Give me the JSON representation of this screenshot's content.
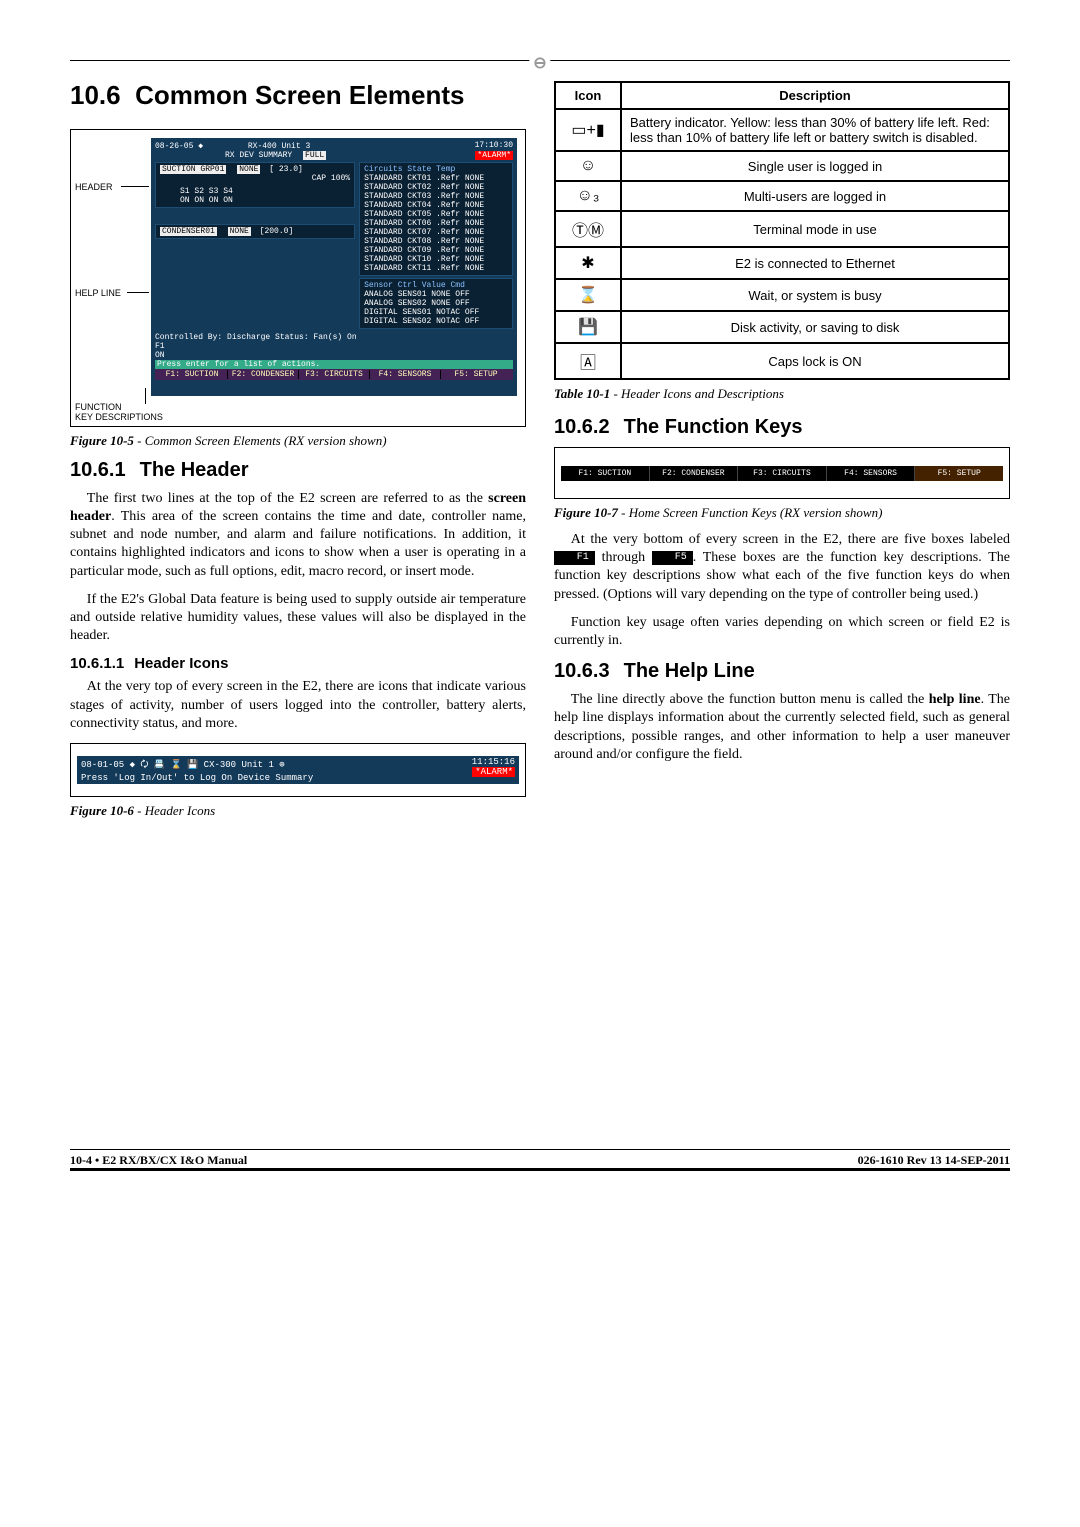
{
  "section": {
    "number": "10.6",
    "title": "Common Screen Elements"
  },
  "fig10_5": {
    "caption_num": "Figure 10-5",
    "caption_text": " - Common Screen Elements (RX version shown)",
    "labels": {
      "header": "HEADER",
      "help_line": "HELP LINE",
      "function": "FUNCTION",
      "key_desc": "KEY DESCRIPTIONS"
    },
    "header_row_left": "08-26-05 ◆",
    "header_row_mid": "RX-400 Unit 3",
    "header_row_time": "17:10:30",
    "header_row2": "RX DEV SUMMARY",
    "header_full": "FULL",
    "header_alarm": "*ALARM*",
    "block1_title": "SUCTION GRP01",
    "block1_none": "NONE",
    "block1_val": "[ 23.0]",
    "block1_cap": "CAP 100%",
    "s_header": "S1  S2  S3  S4",
    "s_row": "ON  ON  ON  ON",
    "circuits_title": "Circuits        State Temp",
    "circuits": [
      "STANDARD CKT01 .Refr NONE",
      "STANDARD CKT02 .Refr NONE",
      "STANDARD CKT03 .Refr NONE",
      "STANDARD CKT04 .Refr NONE",
      "STANDARD CKT05 .Refr NONE",
      "STANDARD CKT06 .Refr NONE",
      "STANDARD CKT07 .Refr NONE",
      "STANDARD CKT08 .Refr NONE",
      "STANDARD CKT09 .Refr NONE",
      "STANDARD CKT10 .Refr NONE",
      "STANDARD CKT11 .Refr NONE"
    ],
    "block2_title": "CONDENSER01",
    "block2_none": "NONE",
    "block2_val": "[200.0]",
    "sensor_title": "Sensor Ctrl    Value  Cmd",
    "sensors": [
      "ANALOG SENS01  NONE   OFF",
      "ANALOG SENS02  NONE   OFF",
      "DIGITAL SENS01 NOTAC  OFF",
      "DIGITAL SENS02 NOTAC  OFF"
    ],
    "help_line_text": "Controlled By: Discharge    Status: Fan(s) On",
    "f_line": "F1\nON",
    "enter_hint": "Press enter for a list of actions.",
    "fkeys": [
      "F1: SUCTION",
      "F2: CONDENSER",
      "F3: CIRCUITS",
      "F4: SENSORS",
      "F5: SETUP"
    ]
  },
  "sub_10_6_1": {
    "num": "10.6.1",
    "title": "The Header",
    "p1": "The first two lines at the top of the E2 screen are referred to as the ",
    "p1b": "screen header",
    "p1c": ". This area of the screen contains the time and date, controller name, subnet and node number, and alarm and failure notifications. In addition, it contains highlighted indicators and icons to show when a user is operating in a particular mode, such as full options, edit, macro record, or insert mode.",
    "p2": "If the E2's Global Data feature is being used to supply outside air temperature and outside relative humidity values, these values will also be displayed in the header."
  },
  "sub_10_6_1_1": {
    "num": "10.6.1.1",
    "title": "Header Icons",
    "p1": "At the very top of every screen in the E2, there are icons that indicate various stages of activity, number of users logged into the controller, battery alerts, connectivity status, and more."
  },
  "fig10_6": {
    "caption_num": "Figure 10-6",
    "caption_text": " - Header Icons",
    "left": "08-01-05 ◆ 🗘 📇   ⌛ 💾     CX-300 Unit 1   ⊕",
    "sub": "Press 'Log In/Out' to Log On    Device Summary",
    "time": "11:15:16",
    "alarm": "*ALARM*"
  },
  "icon_table": {
    "headers": {
      "icon": "Icon",
      "desc": "Description"
    },
    "rows": [
      {
        "icon": "battery",
        "desc": "Battery indicator. Yellow: less than 30% of battery life left. Red: less than 10% of battery life left or battery switch is disabled."
      },
      {
        "icon": "user1",
        "desc": "Single user is logged in"
      },
      {
        "icon": "usern",
        "desc": "Multi-users are logged in"
      },
      {
        "icon": "tm",
        "desc": "Terminal mode in use"
      },
      {
        "icon": "eth",
        "desc": "E2 is connected to Ethernet"
      },
      {
        "icon": "wait",
        "desc": "Wait, or system is busy"
      },
      {
        "icon": "disk",
        "desc": "Disk activity, or saving to disk"
      },
      {
        "icon": "caps",
        "desc": "Caps lock is ON"
      }
    ]
  },
  "tbl10_1": {
    "num": "Table 10-1",
    "text": " - Header Icons and Descriptions"
  },
  "sub_10_6_2": {
    "num": "10.6.2",
    "title": "The Function Keys"
  },
  "fig10_7": {
    "caption_num": "Figure 10-7",
    "caption_text": " - Home Screen Function Keys (RX version shown)",
    "keys": [
      "F1: SUCTION",
      "F2: CONDENSER",
      "F3: CIRCUITS",
      "F4: SENSORS",
      "F5: SETUP"
    ]
  },
  "fk_para": {
    "p1a": "At the very bottom of every screen in the E2, there are five boxes labeled ",
    "k1": "F1",
    "p1b": " through ",
    "k2": "F5",
    "p1c": ". These boxes are the function key descriptions. The function key descriptions show what each of the five function keys do when pressed. (Options will vary depending on the type of controller being used.)",
    "p2": "Function key usage often varies depending on which screen or field E2 is currently in."
  },
  "sub_10_6_3": {
    "num": "10.6.3",
    "title": "The Help Line",
    "p1a": "The line directly above the function button menu is called the ",
    "p1b": "help line",
    "p1c": ". The help line displays information about the currently selected field, such as general descriptions, possible ranges, and other information to help a user maneuver around and/or configure the field."
  },
  "footer": {
    "left_a": "10-4 • ",
    "left_b": "E2 RX/BX/CX I&O Manual",
    "right": "026-1610 Rev 13 14-SEP-2011"
  },
  "icons_glyph": {
    "battery": "▭+▮",
    "user1": "☺",
    "usern": "☺₃",
    "tm": "ⓉⓂ",
    "eth": "✱",
    "wait": "⌛",
    "disk": "💾",
    "caps": "🄰"
  }
}
